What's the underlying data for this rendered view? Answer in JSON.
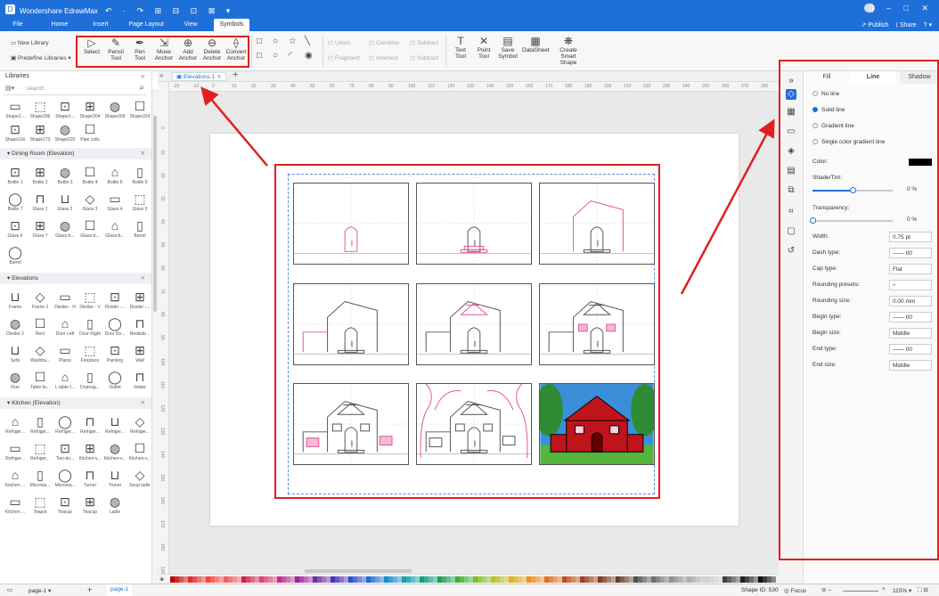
{
  "app": {
    "title": "Wondershare EdrawMax",
    "quick_access": "↶ · ↷ ⊞ ⊟ ⊡ ⊠ ▾"
  },
  "menu": {
    "tabs": [
      "File",
      "Home",
      "Insert",
      "Page Layout",
      "View",
      "Symbols"
    ],
    "active": "Symbols",
    "publish": "Publish",
    "share": "Share"
  },
  "toolbar": {
    "new_library": "New Library",
    "predefine": "Predefine Libraries",
    "tools": [
      {
        "label": "Select",
        "sub": "",
        "icon": "select-arrow-icon",
        "glyph": "▷"
      },
      {
        "label": "Pencil",
        "sub": "Tool",
        "icon": "pencil-icon",
        "glyph": "✎"
      },
      {
        "label": "Pen",
        "sub": "Tool",
        "icon": "pen-icon",
        "glyph": "✒"
      },
      {
        "label": "Move",
        "sub": "Anchor",
        "icon": "move-anchor-icon",
        "glyph": "⇲"
      },
      {
        "label": "Add",
        "sub": "Anchor",
        "icon": "add-anchor-icon",
        "glyph": "⊕"
      },
      {
        "label": "Delete",
        "sub": "Anchor",
        "icon": "delete-anchor-icon",
        "glyph": "⊖"
      },
      {
        "label": "Convert",
        "sub": "Anchor",
        "icon": "convert-anchor-icon",
        "glyph": "⟠"
      }
    ],
    "shapes_row1": [
      "□",
      "○",
      "☆",
      "╲"
    ],
    "shapes_row2": [
      "□",
      "○",
      "◜",
      "◉"
    ],
    "bool_ops": [
      "Union",
      "Combine",
      "Subtract",
      "Fragment",
      "Intersect",
      "Subtract"
    ],
    "text_tool": "Text Tool",
    "point_tool": "Point Tool",
    "save_symbol": "Save Symbol",
    "datasheet": "DataSheet",
    "create_smart": "Create Smart Shape"
  },
  "libraries": {
    "title": "Libraries",
    "search_placeholder": "search",
    "top_row_labels": [
      "Shape1...",
      "Shape286",
      "Shape1...",
      "Shape304",
      "Shape309",
      "Shape324"
    ],
    "top_row2_labels": [
      "Shape316",
      "Shape173",
      "Shape220",
      "Pipe coils"
    ],
    "sections": [
      {
        "title": "Dining Room (Elevation)",
        "rows": [
          [
            "Bottle 1",
            "Bottle 2",
            "Bottle 3",
            "Bottle 4",
            "Bottle 5",
            "Bottle 6"
          ],
          [
            "Bottle 7",
            "Glass 1",
            "Glass 2",
            "Glass 3",
            "Glass 4",
            "Glass 5"
          ],
          [
            "Glass 6",
            "Glass 7",
            "Glass-b...",
            "Glass-b...",
            "Glass-b...",
            "Barrel"
          ],
          [
            "Barrel"
          ]
        ]
      },
      {
        "title": "Elevations",
        "rows": [
          [
            "Frame",
            "Frame 2",
            "Divider - H",
            "Divider - V",
            "Divider -...",
            "Divider -..."
          ],
          [
            "Divider 2",
            "Rect",
            "Door Left",
            "Door Right",
            "Door Do...",
            "Bedside..."
          ],
          [
            "Sofa",
            "Washba...",
            "Plants",
            "Fireplace",
            "Painting",
            "Wall"
          ],
          [
            "Flue",
            "Table fa...",
            "L table f...",
            "Drainag...",
            "Outlet",
            "Intake"
          ]
        ]
      },
      {
        "title": "Kitchen (Elevation)",
        "rows": [
          [
            "Refriger...",
            "Refriger...",
            "Refriger...",
            "Refriger...",
            "Refriger...",
            "Refriger..."
          ],
          [
            "Refriger...",
            "Refriger...",
            "Two-do...",
            "Kitchen-v...",
            "Kitchen-v...",
            "Kitchen-v..."
          ],
          [
            "Kitchen ...",
            "Microwa...",
            "Microwa...",
            "Turner",
            "Truner",
            "Soup ladle"
          ],
          [
            "Kitchen ...",
            "Teapot",
            "Teacup",
            "Teacup",
            "Ladle"
          ]
        ]
      }
    ]
  },
  "document": {
    "tab": "Elevations 1",
    "ruler_h": [
      "-20",
      "-10",
      "0",
      "10",
      "20",
      "30",
      "40",
      "50",
      "60",
      "70",
      "80",
      "90",
      "100",
      "110",
      "120",
      "130",
      "140",
      "150",
      "160",
      "170",
      "180",
      "190",
      "200",
      "210",
      "220",
      "230",
      "240",
      "250",
      "260",
      "270",
      "280"
    ],
    "ruler_v": [
      "0",
      "10",
      "20",
      "30",
      "40",
      "50",
      "60",
      "70",
      "80",
      "90",
      "100",
      "110",
      "120",
      "130",
      "140",
      "150",
      "160",
      "170",
      "180",
      "190",
      "200"
    ]
  },
  "properties": {
    "tabs": [
      "Fill",
      "Line",
      "Shadow"
    ],
    "active_tab": "Line",
    "line_options": [
      "No line",
      "Solid line",
      "Gradient line",
      "Single color gradient line"
    ],
    "selected": "Solid line",
    "color_label": "Color:",
    "shade_label": "Shade/Tint:",
    "shade_value": "0 %",
    "shade_level": 0.5,
    "transparency_label": "Transparency:",
    "transparency_value": "0 %",
    "transparency_level": 0,
    "width_label": "Width:",
    "width_value": "0.75 pt",
    "dash_label": "Dash type:",
    "dash_value": "00",
    "cap_label": "Cap type:",
    "cap_value": "Flat",
    "rounding_presets_label": "Rounding presets:",
    "rounding_size_label": "Rounding size:",
    "rounding_size_value": "0.00 mm",
    "begin_type_label": "Begin type:",
    "begin_type_value": "00",
    "begin_size_label": "Begin size:",
    "begin_size_value": "Middle",
    "end_type_label": "End type:",
    "end_type_value": "00",
    "end_size_label": "End size:",
    "end_size_value": "Middle"
  },
  "status": {
    "page_tab": "page-1",
    "page_tab2": "page-1",
    "shape_id": "Shape ID: 530",
    "focus": "Focus",
    "zoom": "115%"
  },
  "colors": {
    "brand": "#1f6fd9",
    "annotation": "#e02020",
    "pink": "#e0559a",
    "roof": "#c0141c",
    "grass": "#55b43c",
    "sky": "#3b8fd8"
  },
  "palette": [
    "#c00000",
    "#e03030",
    "#ff4040",
    "#f06060",
    "#d02050",
    "#e04080",
    "#c03090",
    "#a020a0",
    "#7030a0",
    "#5030c0",
    "#3050d0",
    "#2070d0",
    "#1090d0",
    "#10a0b0",
    "#10a080",
    "#20a050",
    "#40b030",
    "#80c020",
    "#c0c020",
    "#e0b020",
    "#f09020",
    "#e07020",
    "#c05020",
    "#a04020",
    "#804020",
    "#604030",
    "#505050",
    "#707070",
    "#909090",
    "#b0b0b0",
    "#d0d0d0",
    "#404040",
    "#202020",
    "#101010"
  ]
}
